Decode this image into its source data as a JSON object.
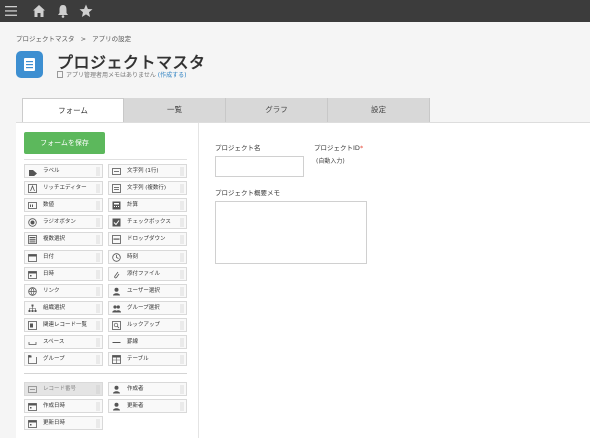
{
  "topbar": {
    "icons": [
      "menu-icon",
      "home-icon",
      "bell-icon",
      "star-icon"
    ]
  },
  "breadcrumb": {
    "items": [
      "プロジェクトマスタ",
      ">",
      "アプリの設定"
    ]
  },
  "app": {
    "title": "プロジェクトマスタ",
    "memo_text": "アプリ管理者用メモはありません",
    "memo_link": "(作成する)"
  },
  "tabs": [
    "フォーム",
    "一覧",
    "グラフ",
    "設定"
  ],
  "save_button": "フォームを保存",
  "palette": {
    "fields": [
      {
        "label": "ラベル",
        "icon": "label-icon"
      },
      {
        "label": "文字列 (1行)",
        "icon": "text-line-icon"
      },
      {
        "label": "リッチエディター",
        "icon": "rich-editor-icon"
      },
      {
        "label": "文字列 (複数行)",
        "icon": "text-multiline-icon"
      },
      {
        "label": "数値",
        "icon": "number-icon"
      },
      {
        "label": "計算",
        "icon": "calc-icon"
      },
      {
        "label": "ラジオボタン",
        "icon": "radio-icon"
      },
      {
        "label": "チェックボックス",
        "icon": "checkbox-icon"
      },
      {
        "label": "複数選択",
        "icon": "multi-select-icon"
      },
      {
        "label": "ドロップダウン",
        "icon": "dropdown-icon"
      },
      {
        "label": "日付",
        "icon": "date-icon"
      },
      {
        "label": "時刻",
        "icon": "clock-icon"
      },
      {
        "label": "日時",
        "icon": "datetime-icon"
      },
      {
        "label": "添付ファイル",
        "icon": "attachment-icon"
      },
      {
        "label": "リンク",
        "icon": "link-icon"
      },
      {
        "label": "ユーザー選択",
        "icon": "user-icon"
      },
      {
        "label": "組織選択",
        "icon": "org-icon"
      },
      {
        "label": "グループ選択",
        "icon": "group-icon"
      },
      {
        "label": "関連レコード一覧",
        "icon": "related-records-icon"
      },
      {
        "label": "ルックアップ",
        "icon": "lookup-icon"
      },
      {
        "label": "スペース",
        "icon": "space-icon"
      },
      {
        "label": "罫線",
        "icon": "line-icon"
      },
      {
        "label": "グループ",
        "icon": "group-box-icon"
      },
      {
        "label": "テーブル",
        "icon": "table-icon"
      }
    ],
    "system_fields": [
      {
        "label": "レコード番号",
        "icon": "record-number-icon"
      },
      {
        "label": "作成者",
        "icon": "user-icon"
      },
      {
        "label": "作成日時",
        "icon": "datetime-icon"
      },
      {
        "label": "更新者",
        "icon": "user-icon"
      },
      {
        "label": "更新日時",
        "icon": "datetime-icon"
      }
    ]
  },
  "form": {
    "project_name_label": "プロジェクト名",
    "project_id_label": "プロジェクトID",
    "required_mark": "*",
    "auto_input": "(自動入力)",
    "memo_label": "プロジェクト概要メモ"
  }
}
